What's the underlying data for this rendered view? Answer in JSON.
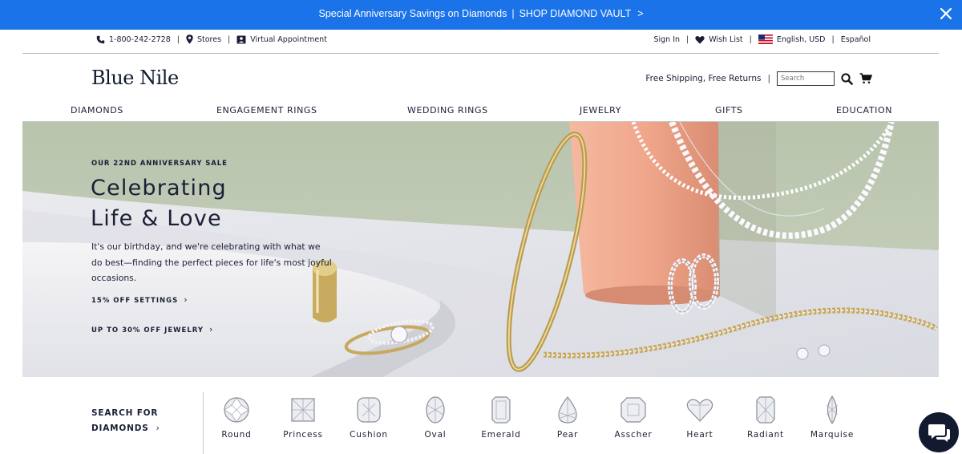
{
  "promo": {
    "text": "Special Anniversary Savings on Diamonds",
    "separator": "|",
    "link": "SHOP DIAMOND VAULT",
    "chevron": ">"
  },
  "utility": {
    "phone": "1-800-242-2728",
    "stores": "Stores",
    "appointment": "Virtual Appointment",
    "sign_in": "Sign In",
    "wish_list": "Wish List",
    "locale": "English, USD",
    "language": "Español",
    "separator": "|"
  },
  "header": {
    "logo": "Blue Nile",
    "shipping": "Free Shipping, Free Returns",
    "search_placeholder": "Search"
  },
  "nav": [
    "DIAMONDS",
    "ENGAGEMENT RINGS",
    "WEDDING RINGS",
    "JEWELRY",
    "GIFTS",
    "EDUCATION"
  ],
  "hero": {
    "eyebrow": "OUR 22ND ANNIVERSARY SALE",
    "title_line1": "Celebrating",
    "title_line2": "Life & Love",
    "description": "It's our birthday, and we're celebrating with what we do best—finding the perfect pieces for life's most joyful occasions.",
    "link1": "15% OFF SETTINGS",
    "link2": "UP TO 30% OFF JEWELRY",
    "chevron": "›"
  },
  "shapes_bar": {
    "title_line1": "SEARCH FOR",
    "title_line2": "DIAMONDS",
    "chevron": "›",
    "shapes": [
      "Round",
      "Princess",
      "Cushion",
      "Oval",
      "Emerald",
      "Pear",
      "Asscher",
      "Heart",
      "Radiant",
      "Marquise"
    ]
  },
  "colors": {
    "promo_blue": "#1a73e8",
    "navy_text": "#1a1f36",
    "hero_wall": "#c3cdb9",
    "hero_pedestal": "#eea78e",
    "gold": "#cdb46a",
    "chat_bubble": "#131a30"
  },
  "icons": [
    "phone-icon",
    "pin-icon",
    "person-icon",
    "heart-icon",
    "us-flag-icon",
    "search-icon",
    "cart-icon",
    "close-icon",
    "chat-icon"
  ]
}
